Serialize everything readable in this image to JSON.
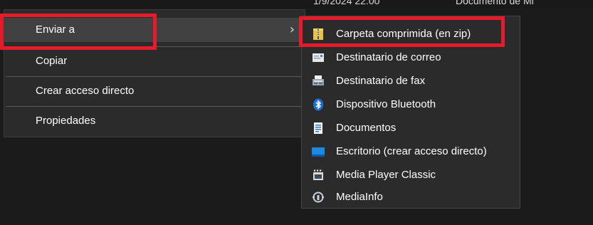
{
  "background": {
    "date_peek": "1/9/2024 22:00",
    "name_peek": "Documento de Mi"
  },
  "main_menu": {
    "items": [
      {
        "label": "Enviar a",
        "submenu_arrow": "›"
      },
      {
        "label": "Copiar"
      },
      {
        "label": "Crear acceso directo"
      },
      {
        "label": "Propiedades"
      }
    ]
  },
  "send_to_menu": {
    "items": [
      {
        "label": "Carpeta comprimida (en zip)",
        "icon": "zip-folder-icon"
      },
      {
        "label": "Destinatario de correo",
        "icon": "mail-icon"
      },
      {
        "label": "Destinatario de fax",
        "icon": "fax-icon"
      },
      {
        "label": "Dispositivo Bluetooth",
        "icon": "bluetooth-icon"
      },
      {
        "label": "Documentos",
        "icon": "documents-icon"
      },
      {
        "label": "Escritorio (crear acceso directo)",
        "icon": "desktop-icon"
      },
      {
        "label": "Media Player Classic",
        "icon": "media-player-icon"
      },
      {
        "label": "MediaInfo",
        "icon": "mediainfo-icon"
      }
    ]
  },
  "colors": {
    "highlight_box": "#e51a2a",
    "menu_bg": "#2b2b2b",
    "hover_bg": "#414141"
  }
}
